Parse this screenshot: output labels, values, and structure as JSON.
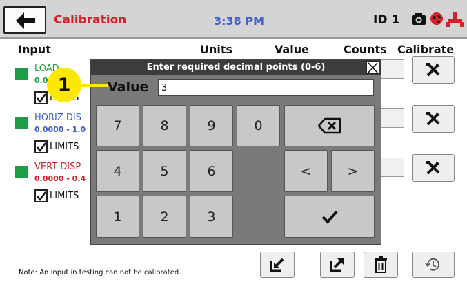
{
  "header": {
    "title": "Calibration",
    "time": "3:38 PM",
    "device_id": "ID 1",
    "icons": [
      "back-arrow-icon",
      "camera-icon",
      "globe-icon",
      "plug-icon"
    ],
    "title_color": "#d2232a",
    "time_color": "#3e5fc8"
  },
  "columns": {
    "input": "Input",
    "units": "Units",
    "value": "Value",
    "counts": "Counts",
    "calibrate": "Calibrate"
  },
  "inputs": [
    {
      "name": "LOAD",
      "range": "0.0...0",
      "limits_label": "LIMITS",
      "color": "#1f9c47"
    },
    {
      "name": "HORIZ DIS",
      "range": "0.0000 - 1.0",
      "limits_label": "LIMITS",
      "color": "#3e5fc8"
    },
    {
      "name": "VERT DISP",
      "range": "0.0000 - 0.4",
      "limits_label": "LIMITS",
      "color": "#d2232a"
    }
  ],
  "note": "Note:  An input in testing can not be calibrated.",
  "dialog": {
    "title": "Enter required decimal points (0-6)",
    "value_label": "Value",
    "value": "3",
    "keys": {
      "k7": "7",
      "k8": "8",
      "k9": "9",
      "k0": "0",
      "k4": "4",
      "k5": "5",
      "k6": "6",
      "k1": "1",
      "k2": "2",
      "k3": "3",
      "left": "<",
      "right": ">"
    }
  },
  "callout": {
    "number": "1"
  }
}
